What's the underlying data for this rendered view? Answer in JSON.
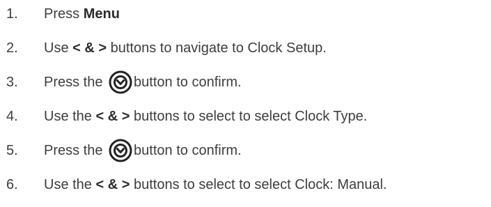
{
  "steps": [
    {
      "number": "1.",
      "parts": {
        "a": "Press ",
        "b": "Menu"
      }
    },
    {
      "number": "2.",
      "parts": {
        "a": "Use ",
        "b": "< & >",
        "c": " buttons to navigate to Clock Setup."
      }
    },
    {
      "number": "3.",
      "parts": {
        "a": "Press the ",
        "b": "button to confirm."
      },
      "icon": "confirm-button-icon"
    },
    {
      "number": "4.",
      "parts": {
        "a": "Use the ",
        "b": "< & >",
        "c": " buttons to select to select Clock Type."
      }
    },
    {
      "number": "5.",
      "parts": {
        "a": "Press the ",
        "b": "button to confirm."
      },
      "icon": "confirm-button-icon"
    },
    {
      "number": "6.",
      "parts": {
        "a": "Use the ",
        "b": "< & >",
        "c": " buttons to select to select Clock: Manual."
      }
    }
  ]
}
